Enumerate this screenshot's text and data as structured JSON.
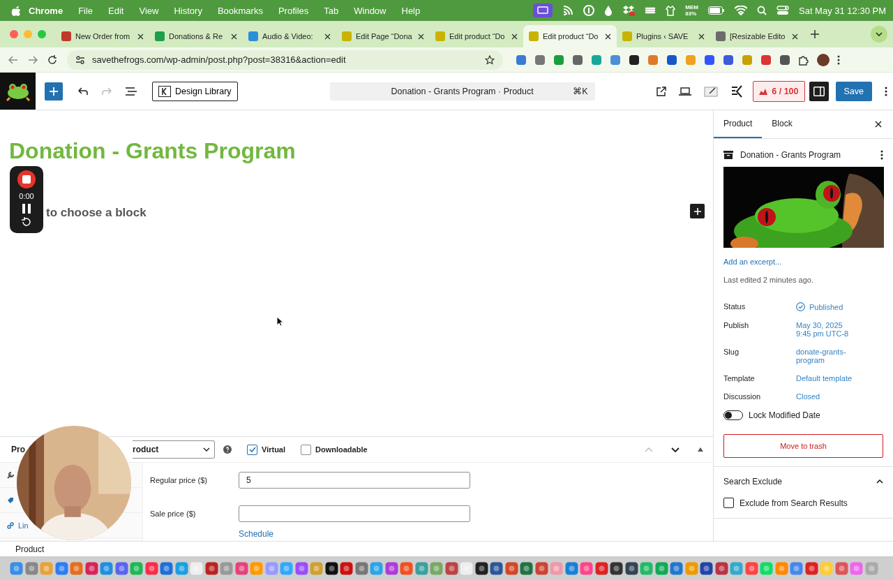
{
  "menubar": {
    "app": "Chrome",
    "menus": [
      "File",
      "Edit",
      "View",
      "History",
      "Bookmarks",
      "Profiles",
      "Tab",
      "Window",
      "Help"
    ],
    "mem_label": "MEM",
    "mem_value": "83%",
    "clock": "Sat May 31  12:30 PM"
  },
  "tabs": [
    {
      "title": "New Order from",
      "selected": false
    },
    {
      "title": "Donations & Re",
      "selected": false
    },
    {
      "title": "Audio & Video:",
      "selected": false
    },
    {
      "title": "Edit Page “Dona",
      "selected": false
    },
    {
      "title": "Edit product “Do",
      "selected": false
    },
    {
      "title": "Edit product “Do",
      "selected": true
    },
    {
      "title": "Plugins ‹ SAVE",
      "selected": false
    },
    {
      "title": "[Resizable Edito",
      "selected": false
    }
  ],
  "address": {
    "url": "savethefrogs.com/wp-admin/post.php?post=38316&action=edit"
  },
  "toolbar": {
    "design_library": "Design Library",
    "command": "Donation - Grants Program · Product",
    "shortcut": "⌘K",
    "seo_score": "6 / 100",
    "sidebar_open": true,
    "save": "Save"
  },
  "canvas": {
    "title": "Donation - Grants Program",
    "placeholder": "to choose a block"
  },
  "recorder": {
    "time": "0:00"
  },
  "product_panel": {
    "label": "Pro",
    "type_select": "roduct",
    "options": [
      {
        "label": "Virtual",
        "checked": true
      },
      {
        "label": "Downloadable",
        "checked": false
      }
    ],
    "side_tab": "Lin",
    "fields": [
      {
        "label": "Regular price ($)",
        "value": "5"
      },
      {
        "label": "Sale price ($)"
      }
    ],
    "schedule": "Schedule"
  },
  "breadcrumb": "Product",
  "sidebar": {
    "tabs": [
      {
        "label": "Product",
        "selected": true
      },
      {
        "label": "Block",
        "selected": false
      }
    ],
    "post_title": "Donation - Grants Program",
    "excerpt_link": "Add an excerpt...",
    "last_edited": "Last edited 2 minutes ago.",
    "rows": [
      {
        "label": "Status",
        "value": "Published",
        "kind": "status"
      },
      {
        "label": "Publish",
        "value": "May 30, 2025 9:45 pm UTC-8",
        "kind": "link"
      },
      {
        "label": "Slug",
        "value": "donate-grants-program",
        "kind": "link"
      },
      {
        "label": "Template",
        "value": "Default template",
        "kind": "link"
      },
      {
        "label": "Discussion",
        "value": "Closed",
        "kind": "link"
      }
    ],
    "lock_toggle": {
      "label": "Lock Modified Date",
      "on": false
    },
    "trash": "Move to trash",
    "search_exclude": {
      "title": "Search Exclude",
      "expanded": true,
      "checkbox": {
        "label": "Exclude from Search Results",
        "checked": false
      }
    }
  }
}
